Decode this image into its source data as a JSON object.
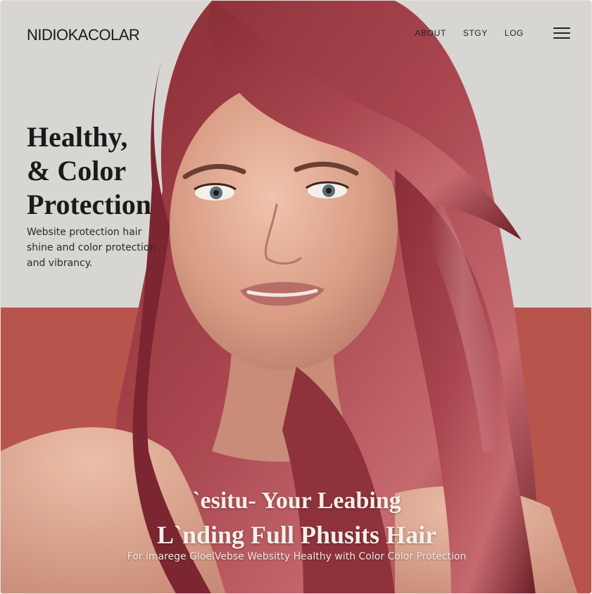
{
  "brand": "NIDIOKACOLAR",
  "nav": {
    "about": "ABOUT",
    "stgy": "STGY",
    "log": "LOG"
  },
  "hero": {
    "headline": [
      "Healthy,",
      "& Color",
      "Protection"
    ],
    "description": "Website protection hair shine and color protection and vibrancy."
  },
  "bottom": {
    "line1": "`esitu- Your Leabing",
    "line2": "L`nding Full Phusits Hair",
    "subtitle": "For imarege GloelVebse Websitty Healthy with Color Color Protection"
  }
}
